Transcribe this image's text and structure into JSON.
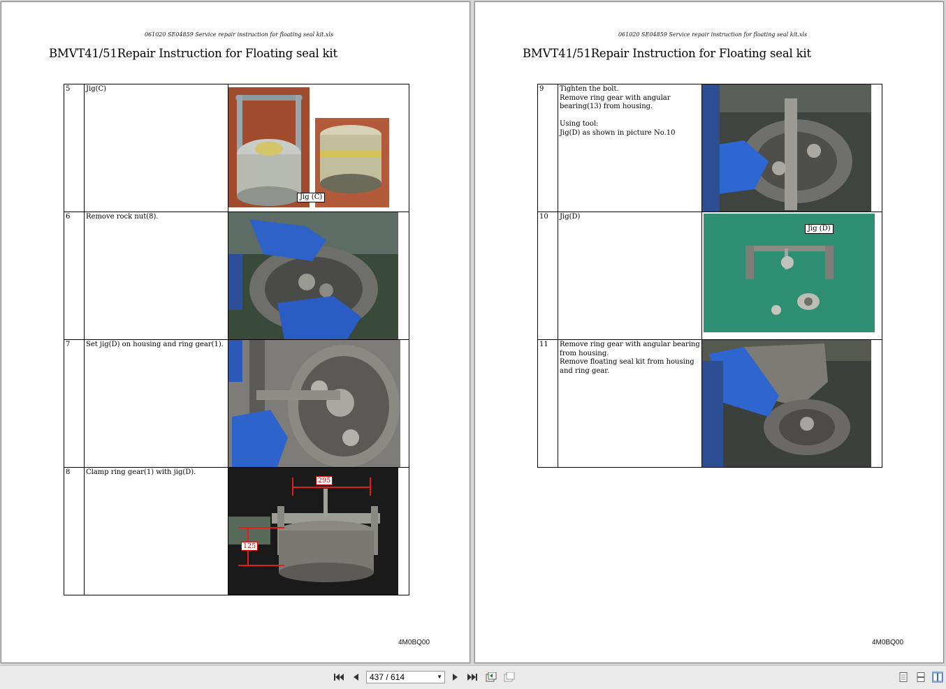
{
  "document": {
    "file_header": "061020 SE04859 Service repair instruction for floating seal kit.xls",
    "title": "BMVT41/51Repair Instruction for Floating seal kit",
    "footer_code": "4M0BQ00"
  },
  "left_page": {
    "steps": [
      {
        "num": "5",
        "desc": "Jig(C)",
        "callouts": [
          "Jig (C)"
        ]
      },
      {
        "num": "6",
        "desc": "Remove rock nut(8).",
        "callouts": []
      },
      {
        "num": "7",
        "desc": "Set jig(D) on housing and ring gear(1).",
        "callouts": []
      },
      {
        "num": "8",
        "desc": "Clamp ring gear(1) with jig(D).",
        "callouts": [],
        "dimensions": [
          "295",
          "125"
        ]
      }
    ]
  },
  "right_page": {
    "steps": [
      {
        "num": "9",
        "desc": "Tighten the bolt.\nRemove ring gear with angular bearing(13) from housing.\n\nUsing tool:\nJig(D) as shown in picture No.10",
        "callouts": []
      },
      {
        "num": "10",
        "desc": "Jig(D)",
        "callouts": [
          "Jig (D)"
        ]
      },
      {
        "num": "11",
        "desc": "Remove ring gear with angular bearing from housing.\nRemove floating seal kit from housing and ring gear.",
        "callouts": []
      }
    ]
  },
  "toolbar": {
    "page_indicator": "437 / 614",
    "icons": [
      "first-page-icon",
      "prev-page-icon",
      "next-page-icon",
      "last-page-icon",
      "previous-view-icon",
      "next-view-icon",
      "single-page-view-icon",
      "continuous-view-icon",
      "facing-view-icon"
    ]
  }
}
